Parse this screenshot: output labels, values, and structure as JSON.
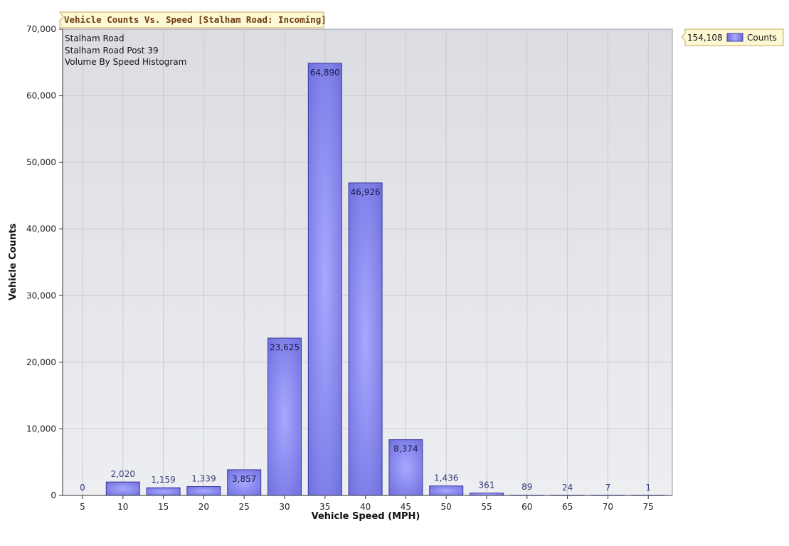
{
  "colors": {
    "plot_bg_top": "#dcdde2",
    "plot_bg_bottom": "#eceef2",
    "grid": "#c9cbd1",
    "bar_dark": "#6b6bdc",
    "bar_light": "#a8a8ff",
    "bar_stroke": "#3a3a9a",
    "title_bg": "#fdf8d4",
    "title_border": "#c9a75a",
    "title_text": "#6b3a0e"
  },
  "legend": {
    "total": "154,108",
    "series_label": "Counts",
    "position": "top-right (outside plot)"
  },
  "chart_data": {
    "type": "bar",
    "title": "Vehicle Counts Vs. Speed [Stalham Road: Incoming]",
    "info_lines": [
      "Stalham Road",
      "Stalham Road Post 39",
      "Volume By Speed Histogram"
    ],
    "xlabel": "Vehicle Speed (MPH)",
    "ylabel": "Vehicle Counts",
    "ylim": [
      0,
      70000
    ],
    "yticks": [
      0,
      10000,
      20000,
      30000,
      40000,
      50000,
      60000,
      70000
    ],
    "ytick_labels": [
      "0",
      "10,000",
      "20,000",
      "30,000",
      "40,000",
      "50,000",
      "60,000",
      "70,000"
    ],
    "grid": true,
    "categories": [
      "5",
      "10",
      "15",
      "20",
      "25",
      "30",
      "35",
      "40",
      "45",
      "50",
      "55",
      "60",
      "65",
      "70",
      "75"
    ],
    "series": [
      {
        "name": "Counts",
        "values": [
          0,
          2020,
          1159,
          1339,
          3857,
          23625,
          64890,
          46926,
          8374,
          1436,
          361,
          89,
          24,
          7,
          1
        ],
        "labels": [
          "0",
          "2,020",
          "1,159",
          "1,339",
          "3,857",
          "23,625",
          "64,890",
          "46,926",
          "8,374",
          "1,436",
          "361",
          "89",
          "24",
          "7",
          "1"
        ]
      }
    ]
  }
}
